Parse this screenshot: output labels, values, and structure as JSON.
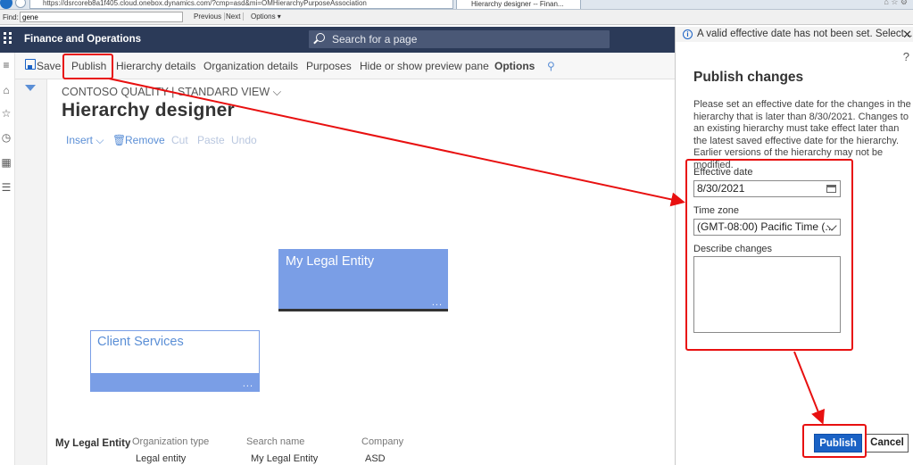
{
  "browser": {
    "address": "https://dsrcoreb8a1f405.cloud.onebox.dynamics.com/?cmp=asd&mi=OMHierarchyPurposeAssociation",
    "tab_title": "Hierarchy designer -- Finan..."
  },
  "find_bar": {
    "label": "Find:",
    "value": "gene",
    "previous": "Previous",
    "next": "Next",
    "options": "Options ▾"
  },
  "app": {
    "title": "Finance and Operations",
    "search_placeholder": "Search for a page"
  },
  "action_pane": {
    "save": "Save",
    "publish": "Publish",
    "hierarchy_details": "Hierarchy details",
    "organization_details": "Organization details",
    "purposes": "Purposes",
    "hide_show_preview": "Hide or show preview pane",
    "options": "Options"
  },
  "page": {
    "breadcrumb": "CONTOSO QUALITY  |  STANDARD VIEW ⌵",
    "title": "Hierarchy designer",
    "toolbar": {
      "insert": "Insert ⌵",
      "remove": "Remove",
      "cut": "Cut",
      "paste": "Paste",
      "undo": "Undo"
    }
  },
  "nodes": {
    "root": {
      "label": "My Legal Entity",
      "more": "..."
    },
    "child": {
      "label": "Client Services",
      "more": "..."
    }
  },
  "preview": {
    "entity": "My Legal Entity",
    "org_type_header": "Organization type",
    "org_type_value": "Legal entity",
    "search_name_header": "Search name",
    "search_name_value": "My Legal Entity",
    "company_header": "Company",
    "company_value": "ASD"
  },
  "side_pane": {
    "message": "A valid effective date has not been set. Select...",
    "help": "?",
    "title": "Publish changes",
    "description": "Please set an effective date for the changes in the hierarchy that is later than 8/30/2021. Changes to an existing hierarchy must take effect later than the latest saved effective date for the hierarchy. Earlier versions of the hierarchy may not be modified.",
    "effective_date_label": "Effective date",
    "effective_date_value": "8/30/2021",
    "time_zone_label": "Time zone",
    "time_zone_value": "(GMT-08:00) Pacific Time (...",
    "describe_label": "Describe changes",
    "describe_value": "",
    "publish_button": "Publish",
    "cancel_button": "Cancel"
  },
  "colors": {
    "header": "#2b3a58",
    "accent": "#1a62c5",
    "node": "#7a9ee6",
    "annotation": "#e81010"
  }
}
